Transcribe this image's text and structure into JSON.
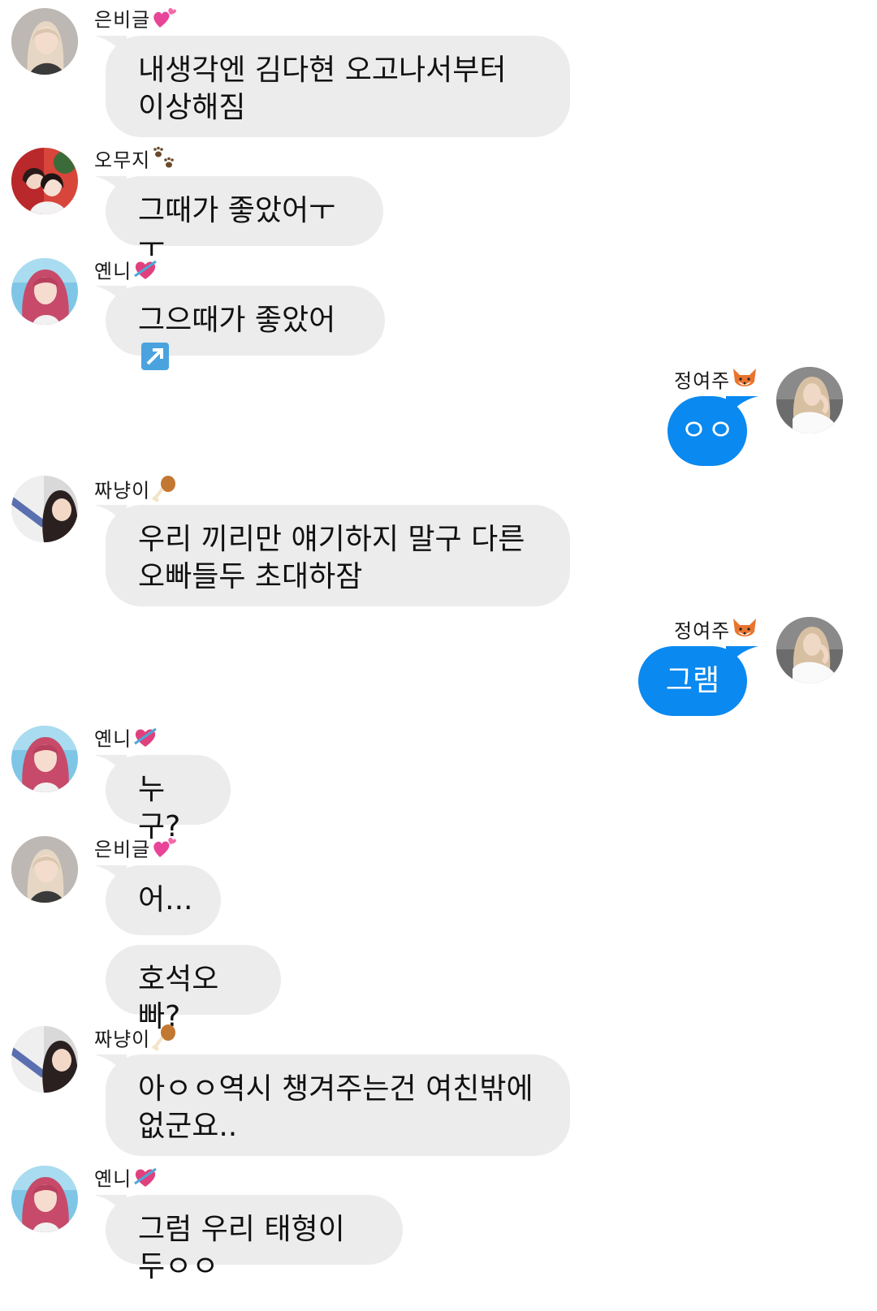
{
  "colors": {
    "incoming_bubble": "#ececec",
    "outgoing_bubble": "#0a89f0",
    "background": "#ffffff"
  },
  "messages": [
    {
      "sender": "은비글",
      "emoji": "pink-hearts",
      "text": [
        "내생각엔 김다현 오고나서부터",
        "이상해짐"
      ],
      "side": "left"
    },
    {
      "sender": "오무지",
      "emoji": "paw-prints",
      "text": [
        "그때가 좋았어ㅜㅜ"
      ],
      "side": "left"
    },
    {
      "sender": "옌니",
      "emoji": "heart-with-arrow",
      "text": [
        "그으때가 좋았어"
      ],
      "side": "left"
    },
    {
      "sender": "정여주",
      "emoji": "fox",
      "text": [
        "ㅇㅇ"
      ],
      "side": "right"
    },
    {
      "sender": "짜냥이",
      "emoji": "poultry-leg",
      "text": [
        "우리 끼리만 얘기하지 말구 다른",
        "오빠들두 초대하잠"
      ],
      "side": "left"
    },
    {
      "sender": "정여주",
      "emoji": "fox",
      "text": [
        "그램"
      ],
      "side": "right"
    },
    {
      "sender": "옌니",
      "emoji": "heart-with-arrow",
      "text": [
        "누구?"
      ],
      "side": "left"
    },
    {
      "sender": "은비글",
      "emoji": "pink-hearts",
      "text": [
        "어...",
        "호석오빠?"
      ],
      "side": "left"
    },
    {
      "sender": "짜냥이",
      "emoji": "poultry-leg",
      "text": [
        "아ㅇㅇ역시 챙겨주는건 여친밖에",
        "없군요.."
      ],
      "side": "left"
    },
    {
      "sender": "옌니",
      "emoji": "heart-with-arrow",
      "text": [
        "그럼 우리 태형이두ㅇㅇ"
      ],
      "side": "left"
    }
  ]
}
